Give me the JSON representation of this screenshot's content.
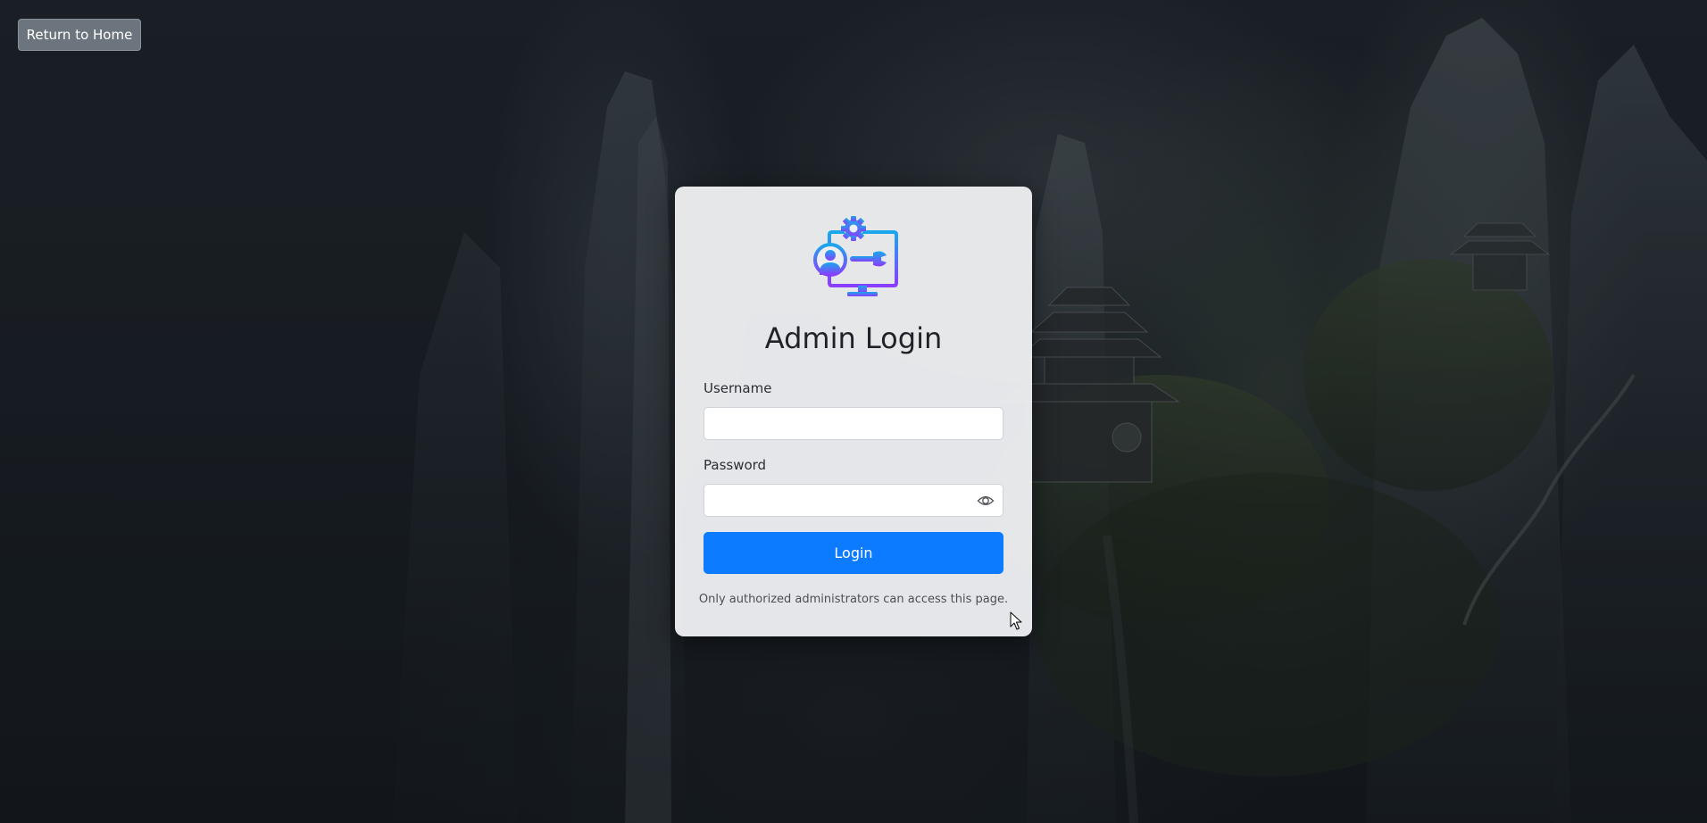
{
  "header": {
    "return_label": "Return to Home"
  },
  "login": {
    "logo_icon": "admin-settings-monitor-icon",
    "title": "Admin Login",
    "username_label": "Username",
    "username_value": "",
    "password_label": "Password",
    "password_value": "",
    "password_toggle_icon": "eye-icon",
    "submit_label": "Login",
    "notice": "Only authorized administrators can access this page."
  },
  "colors": {
    "primary": "#0d7bff",
    "secondary_button": "#6c757d",
    "logo_gradient_start": "#1aa7ec",
    "logo_gradient_end": "#8b3dff"
  }
}
